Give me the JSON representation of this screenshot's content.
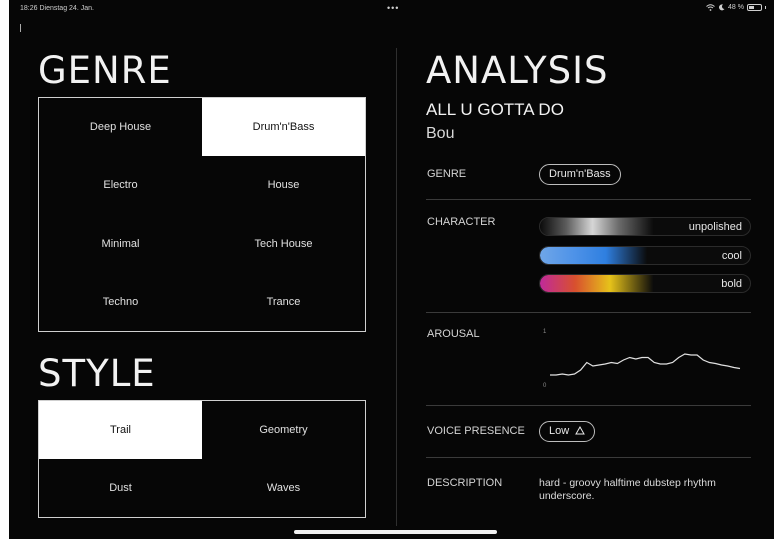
{
  "status": {
    "time_date": "18:26  Dienstag 24. Jan.",
    "dots": "•••",
    "battery": "48 %"
  },
  "genre_section": {
    "title": "GENRE",
    "options": [
      "Deep House",
      "Drum'n'Bass",
      "Electro",
      "House",
      "Minimal",
      "Tech House",
      "Techno",
      "Trance"
    ],
    "selected": "Drum'n'Bass"
  },
  "style_section": {
    "title": "STYLE",
    "options": [
      "Trail",
      "Geometry",
      "Dust",
      "Waves"
    ],
    "selected": "Trail"
  },
  "analysis": {
    "title": "ANALYSIS",
    "track_title": "ALL U GOTTA DO",
    "artist": "Bou",
    "genre_label": "GENRE",
    "genre_value": "Drum'n'Bass",
    "character_label": "CHARACTER",
    "character": [
      {
        "label": "unpolished",
        "level": 0.5,
        "colors": [
          "#0b0b0b",
          "#5c5c5c",
          "#d6d6d6",
          "#6b6b6b",
          "#0b0b0b"
        ]
      },
      {
        "label": "cool",
        "level": 0.47,
        "colors": [
          "#6fa6e8",
          "#4f93e8",
          "#2f7fe0",
          "#0b0b0b"
        ]
      },
      {
        "label": "bold",
        "level": 0.5,
        "colors": [
          "#c02a9a",
          "#d8502e",
          "#e6c21a",
          "#0b0b0b"
        ]
      }
    ],
    "arousal_label": "AROUSAL",
    "arousal_axis": {
      "max": "1",
      "min": "0"
    },
    "arousal_values": [
      0.2,
      0.2,
      0.22,
      0.2,
      0.22,
      0.3,
      0.45,
      0.38,
      0.4,
      0.42,
      0.45,
      0.43,
      0.5,
      0.55,
      0.52,
      0.55,
      0.55,
      0.45,
      0.42,
      0.42,
      0.45,
      0.55,
      0.62,
      0.6,
      0.6,
      0.5,
      0.45,
      0.43,
      0.4,
      0.38,
      0.35,
      0.33
    ],
    "voice_label": "VOICE PRESENCE",
    "voice_value": "Low",
    "description_label": "DESCRIPTION",
    "description": "hard - groovy halftime dubstep rhythm underscore."
  },
  "colors": {
    "background": "#060606",
    "selected_bg": "#ffffff",
    "line": "#cfcfcf"
  }
}
